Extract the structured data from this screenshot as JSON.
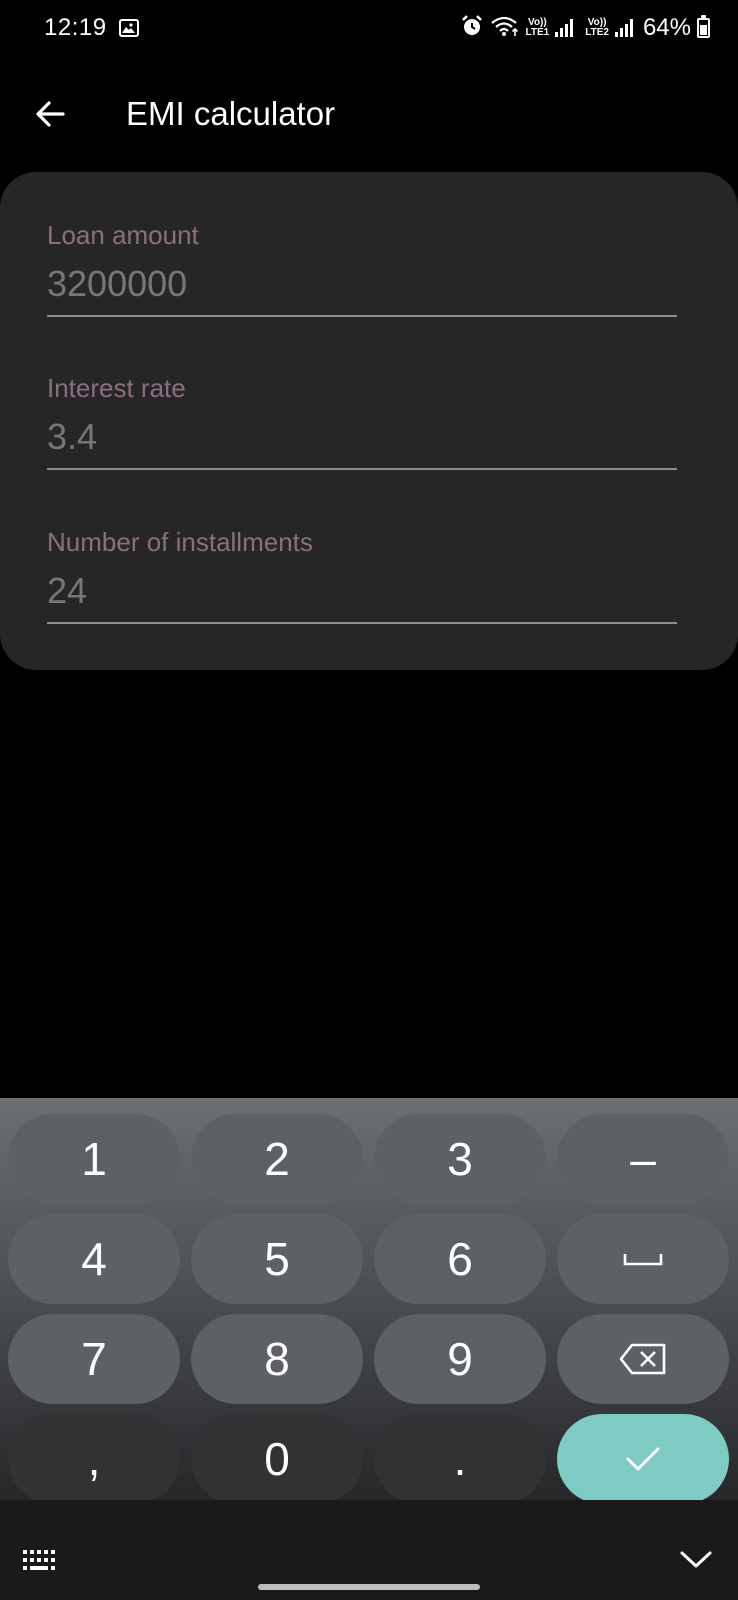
{
  "status_bar": {
    "time": "12:19",
    "sim1_top": "Vo))",
    "sim1_bottom": "LTE1",
    "sim2_top": "Vo))",
    "sim2_bottom": "LTE2",
    "battery": "64%",
    "battery_level": 0.64,
    "icons": [
      "gallery-icon",
      "alarm-icon",
      "wifi-icon",
      "signal-icon",
      "battery-icon"
    ]
  },
  "app_bar": {
    "title": "EMI calculator",
    "back_icon": "arrow-left-icon"
  },
  "form": {
    "fields": [
      {
        "label": "Loan amount",
        "value": "3200000"
      },
      {
        "label": "Interest rate",
        "value": "3.4"
      },
      {
        "label": "Number of installments",
        "value": "24"
      }
    ]
  },
  "keyboard": {
    "rows": [
      [
        "1",
        "2",
        "3",
        "–"
      ],
      [
        "4",
        "5",
        "6",
        "space"
      ],
      [
        "7",
        "8",
        "9",
        "backspace"
      ],
      [
        ",",
        "0",
        ".",
        "done"
      ]
    ],
    "key_labels": {
      "k1": "1",
      "k2": "2",
      "k3": "3",
      "minus": "–",
      "k4": "4",
      "k5": "5",
      "k6": "6",
      "k7": "7",
      "k8": "8",
      "k9": "9",
      "comma": ",",
      "k0": "0",
      "dot": "."
    },
    "colors": {
      "key": "#5d6064",
      "key_dark": "#303234",
      "confirm": "#7ecbc3"
    }
  },
  "colors": {
    "background": "#000000",
    "card": "#262626",
    "label": "#8a6f80",
    "value": "#777777"
  }
}
